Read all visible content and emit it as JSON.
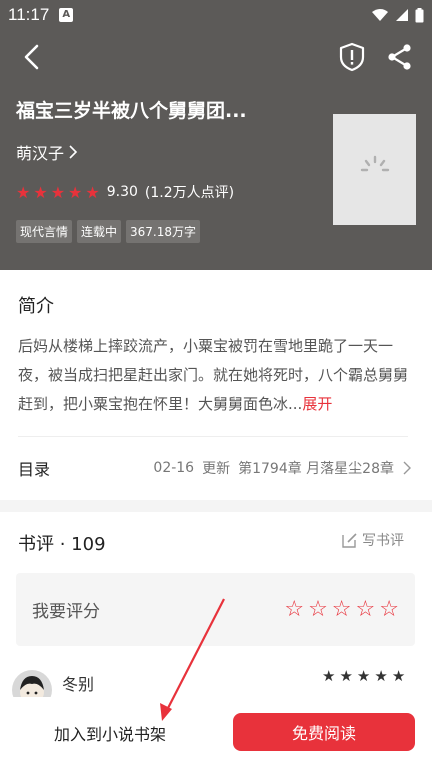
{
  "status_bar": {
    "time": "11:17",
    "app_letter": "A"
  },
  "book": {
    "title": "福宝三岁半被八个舅舅团...",
    "author": "萌汉子",
    "rating_score": "9.30",
    "rating_count": "(1.2万人点评)",
    "stars": 5,
    "tags": [
      "现代言情",
      "连载中",
      "367.18万字"
    ]
  },
  "intro": {
    "title": "简介",
    "text": "后妈从楼梯上摔跤流产，小粟宝被罚在雪地里跪了一天一夜，被当成扫把星赶出家门。就在她将死时，八个霸总舅舅赶到，把小粟宝抱在怀里！大舅舅面色冰...",
    "expand_label": "展开"
  },
  "toc": {
    "label": "目录",
    "date": "02-16",
    "update_label": "更新",
    "latest_chapter": "第1794章 月落星尘28章"
  },
  "reviews": {
    "title": "书评 · 109",
    "write_label": "写书评",
    "rate_label": "我要评分",
    "comment": {
      "user": "冬别",
      "stars": 5
    }
  },
  "bottom": {
    "shelf_label": "加入到小说书架",
    "read_label": "免费阅读"
  },
  "colors": {
    "header_bg": "#5c5a58",
    "accent": "#e8323b"
  }
}
